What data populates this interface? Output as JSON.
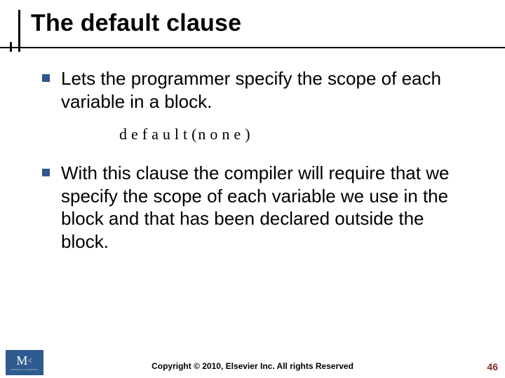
{
  "title": "The default clause",
  "bullets": [
    "Lets the programmer specify the scope of each variable in a block.",
    "With this clause the compiler will require that we specify the scope of each variable we use in the block and that has been declared outside the block."
  ],
  "code": {
    "keyword": "default",
    "open": "(",
    "arg": "none",
    "close": ")"
  },
  "footer": {
    "copyright": "Copyright © 2010, Elsevier Inc. All rights Reserved",
    "page_number": "46",
    "logo_main": "M",
    "logo_lt": "<",
    "logo_sub": "MORGAN KAUFMANN"
  },
  "colors": {
    "bullet_square": "#30568c",
    "logo_bg": "#2f5a8f",
    "page_number": "#8a2a2a"
  }
}
